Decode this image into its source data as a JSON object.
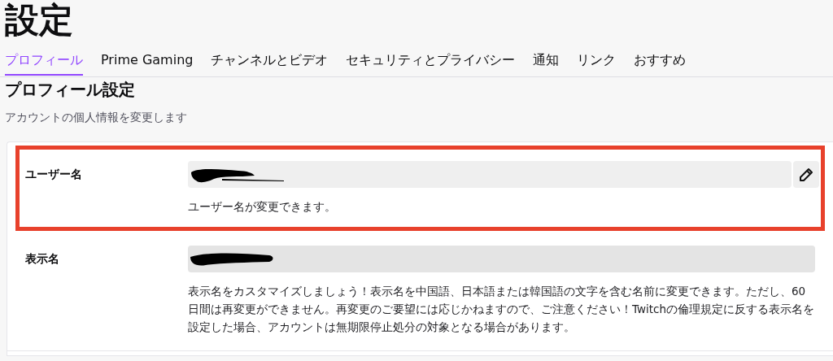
{
  "page": {
    "title": "設定"
  },
  "tabs": [
    {
      "label": "プロフィール",
      "selected": true
    },
    {
      "label": "Prime Gaming",
      "selected": false
    },
    {
      "label": "チャンネルとビデオ",
      "selected": false
    },
    {
      "label": "セキュリティとプライバシー",
      "selected": false
    },
    {
      "label": "通知",
      "selected": false
    },
    {
      "label": "リンク",
      "selected": false
    },
    {
      "label": "おすすめ",
      "selected": false
    }
  ],
  "section": {
    "heading": "プロフィール設定",
    "subtitle": "アカウントの個人情報を変更します"
  },
  "rows": [
    {
      "label": "ユーザー名",
      "highlighted": true,
      "editable": true,
      "help": "ユーザー名が変更できます。"
    },
    {
      "label": "表示名",
      "highlighted": false,
      "editable": false,
      "help": "表示名をカスタマイズしましょう！表示名を中国語、日本語または韓国語の文字を含む名前に変更できます。ただし、60日間は再変更ができません。再変更のご要望には応じかねますので、ご注意ください！Twitchの倫理規定に反する表示名を設定した場合、アカウントは無期限停止処分の対象となる場合があります。"
    }
  ]
}
